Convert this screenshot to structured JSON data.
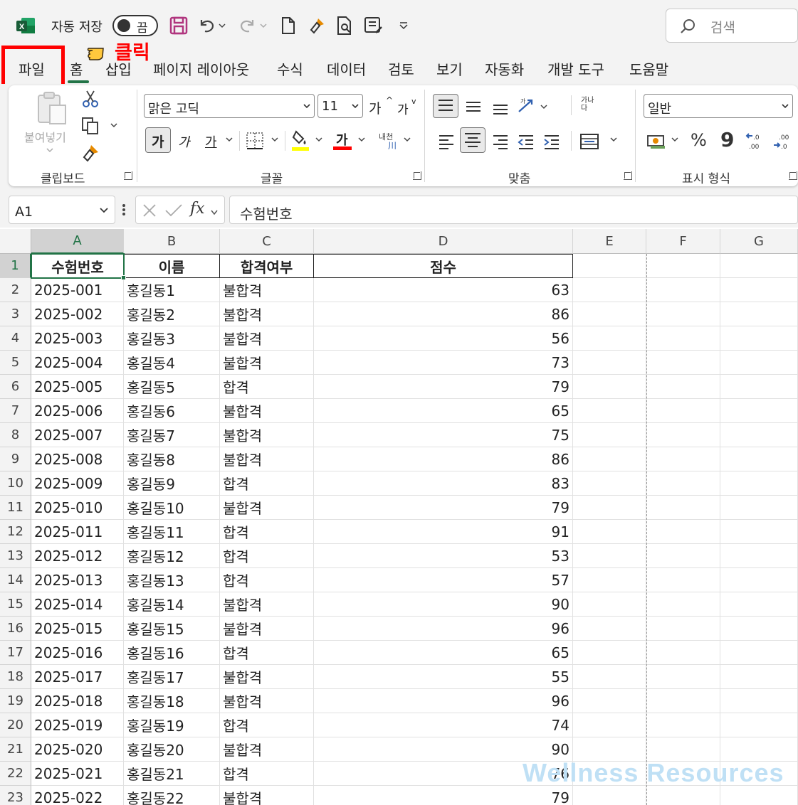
{
  "titlebar": {
    "autosave_label": "자동 저장",
    "autosave_state": "끔",
    "search_placeholder": "검색"
  },
  "tabs": [
    {
      "label": "파일"
    },
    {
      "label": "홈"
    },
    {
      "label": "삽입"
    },
    {
      "label": "페이지 레이아웃"
    },
    {
      "label": "수식"
    },
    {
      "label": "데이터"
    },
    {
      "label": "검토"
    },
    {
      "label": "보기"
    },
    {
      "label": "자동화"
    },
    {
      "label": "개발 도구"
    },
    {
      "label": "도움말"
    }
  ],
  "annotation": {
    "click_text": "클릭",
    "highlight_color": "#ff0000"
  },
  "ribbon": {
    "clipboard": {
      "label": "클립보드",
      "paste_label": "붙여넣기"
    },
    "font": {
      "label": "글꼴",
      "font_name": "맑은 고딕",
      "font_size": "11",
      "bold": "가",
      "italic": "가",
      "underline": "가",
      "color_letter": "가",
      "grow": "가",
      "shrink": "가",
      "phonetic": "내천"
    },
    "alignment": {
      "label": "맞춤",
      "wrap": "가나 다"
    },
    "number": {
      "label": "표시 형식",
      "format": "일반",
      "percent": "%",
      "comma": "9"
    }
  },
  "formula_bar": {
    "name_box": "A1",
    "fx": "fx",
    "formula": "수험번호"
  },
  "sheet": {
    "columns": [
      "A",
      "B",
      "C",
      "D",
      "E",
      "F",
      "G"
    ],
    "header": [
      "수험번호",
      "이름",
      "합격여부",
      "점수"
    ],
    "rows": [
      [
        "2025-001",
        "홍길동1",
        "불합격",
        "63"
      ],
      [
        "2025-002",
        "홍길동2",
        "불합격",
        "86"
      ],
      [
        "2025-003",
        "홍길동3",
        "불합격",
        "56"
      ],
      [
        "2025-004",
        "홍길동4",
        "불합격",
        "73"
      ],
      [
        "2025-005",
        "홍길동5",
        "합격",
        "79"
      ],
      [
        "2025-006",
        "홍길동6",
        "불합격",
        "65"
      ],
      [
        "2025-007",
        "홍길동7",
        "불합격",
        "75"
      ],
      [
        "2025-008",
        "홍길동8",
        "불합격",
        "86"
      ],
      [
        "2025-009",
        "홍길동9",
        "합격",
        "83"
      ],
      [
        "2025-010",
        "홍길동10",
        "불합격",
        "79"
      ],
      [
        "2025-011",
        "홍길동11",
        "합격",
        "91"
      ],
      [
        "2025-012",
        "홍길동12",
        "합격",
        "53"
      ],
      [
        "2025-013",
        "홍길동13",
        "합격",
        "57"
      ],
      [
        "2025-014",
        "홍길동14",
        "불합격",
        "90"
      ],
      [
        "2025-015",
        "홍길동15",
        "불합격",
        "96"
      ],
      [
        "2025-016",
        "홍길동16",
        "합격",
        "65"
      ],
      [
        "2025-017",
        "홍길동17",
        "불합격",
        "55"
      ],
      [
        "2025-018",
        "홍길동18",
        "불합격",
        "96"
      ],
      [
        "2025-019",
        "홍길동19",
        "합격",
        "74"
      ],
      [
        "2025-020",
        "홍길동20",
        "불합격",
        "90"
      ],
      [
        "2025-021",
        "홍길동21",
        "합격",
        "76"
      ],
      [
        "2025-022",
        "홍길동22",
        "불합격",
        "79"
      ]
    ]
  },
  "watermark": "Wellness Resources",
  "colors": {
    "excel_green": "#217346",
    "accent_red": "#ff0000"
  }
}
